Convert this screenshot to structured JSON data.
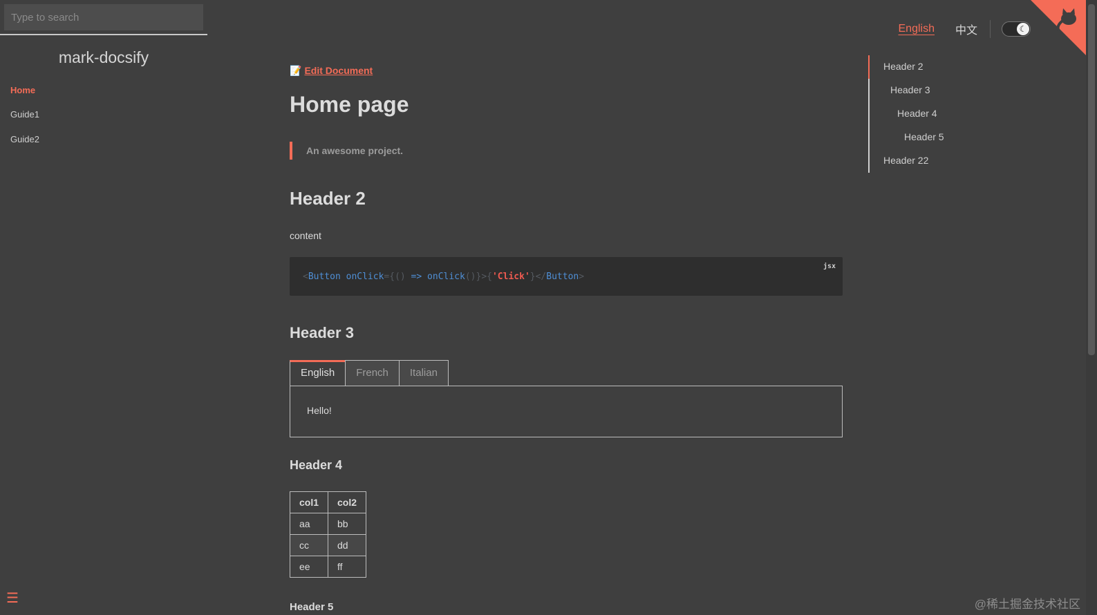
{
  "search": {
    "placeholder": "Type to search"
  },
  "sidebar": {
    "app_name": "mark-docsify",
    "items": [
      {
        "label": "Home",
        "active": true
      },
      {
        "label": "Guide1",
        "active": false
      },
      {
        "label": "Guide2",
        "active": false
      }
    ],
    "menu_icon": "hamburger-icon"
  },
  "topnav": {
    "languages": [
      {
        "label": "English",
        "active": true
      },
      {
        "label": "中文",
        "active": false
      }
    ],
    "theme_toggle": {
      "icon": "moon-icon",
      "state": "dark"
    }
  },
  "corner": {
    "icon": "github-octocat-icon"
  },
  "content": {
    "edit_link": "Edit Document",
    "edit_icon": "memo-icon",
    "title": "Home page",
    "blockquote": "An awesome project.",
    "h2": "Header 2",
    "paragraph": "content",
    "code": {
      "lang": "jsx",
      "tokens": {
        "open_lt": "<",
        "tag": "Button",
        "attr": "onClick",
        "eq_brace": "={()",
        "arrow": " =>",
        "call": "onClick",
        "call_close": "()}>",
        "brace_open": "{",
        "string": "'Click'",
        "brace_close": "}</",
        "close_tag": "Button",
        "gt": ">"
      }
    },
    "h3": "Header 3",
    "tabs": [
      {
        "label": "English",
        "active": true
      },
      {
        "label": "French",
        "active": false
      },
      {
        "label": "Italian",
        "active": false
      }
    ],
    "tab_content": "Hello!",
    "h4": "Header 4",
    "table": {
      "headers": [
        "col1",
        "col2"
      ],
      "rows": [
        [
          "aa",
          "bb"
        ],
        [
          "cc",
          "dd"
        ],
        [
          "ee",
          "ff"
        ]
      ]
    },
    "h5": "Header 5"
  },
  "toc": [
    {
      "label": "Header 2",
      "level": 2,
      "active": true
    },
    {
      "label": "Header 3",
      "level": 3,
      "active": false
    },
    {
      "label": "Header 4",
      "level": 4,
      "active": false
    },
    {
      "label": "Header 5",
      "level": 5,
      "active": false
    },
    {
      "label": "Header 22",
      "level": 2,
      "active": false
    }
  ],
  "watermark": "@稀土掘金技术社区",
  "colors": {
    "accent": "#f46c57",
    "background": "#3f3f3f",
    "code_background": "#2e2e2e"
  }
}
